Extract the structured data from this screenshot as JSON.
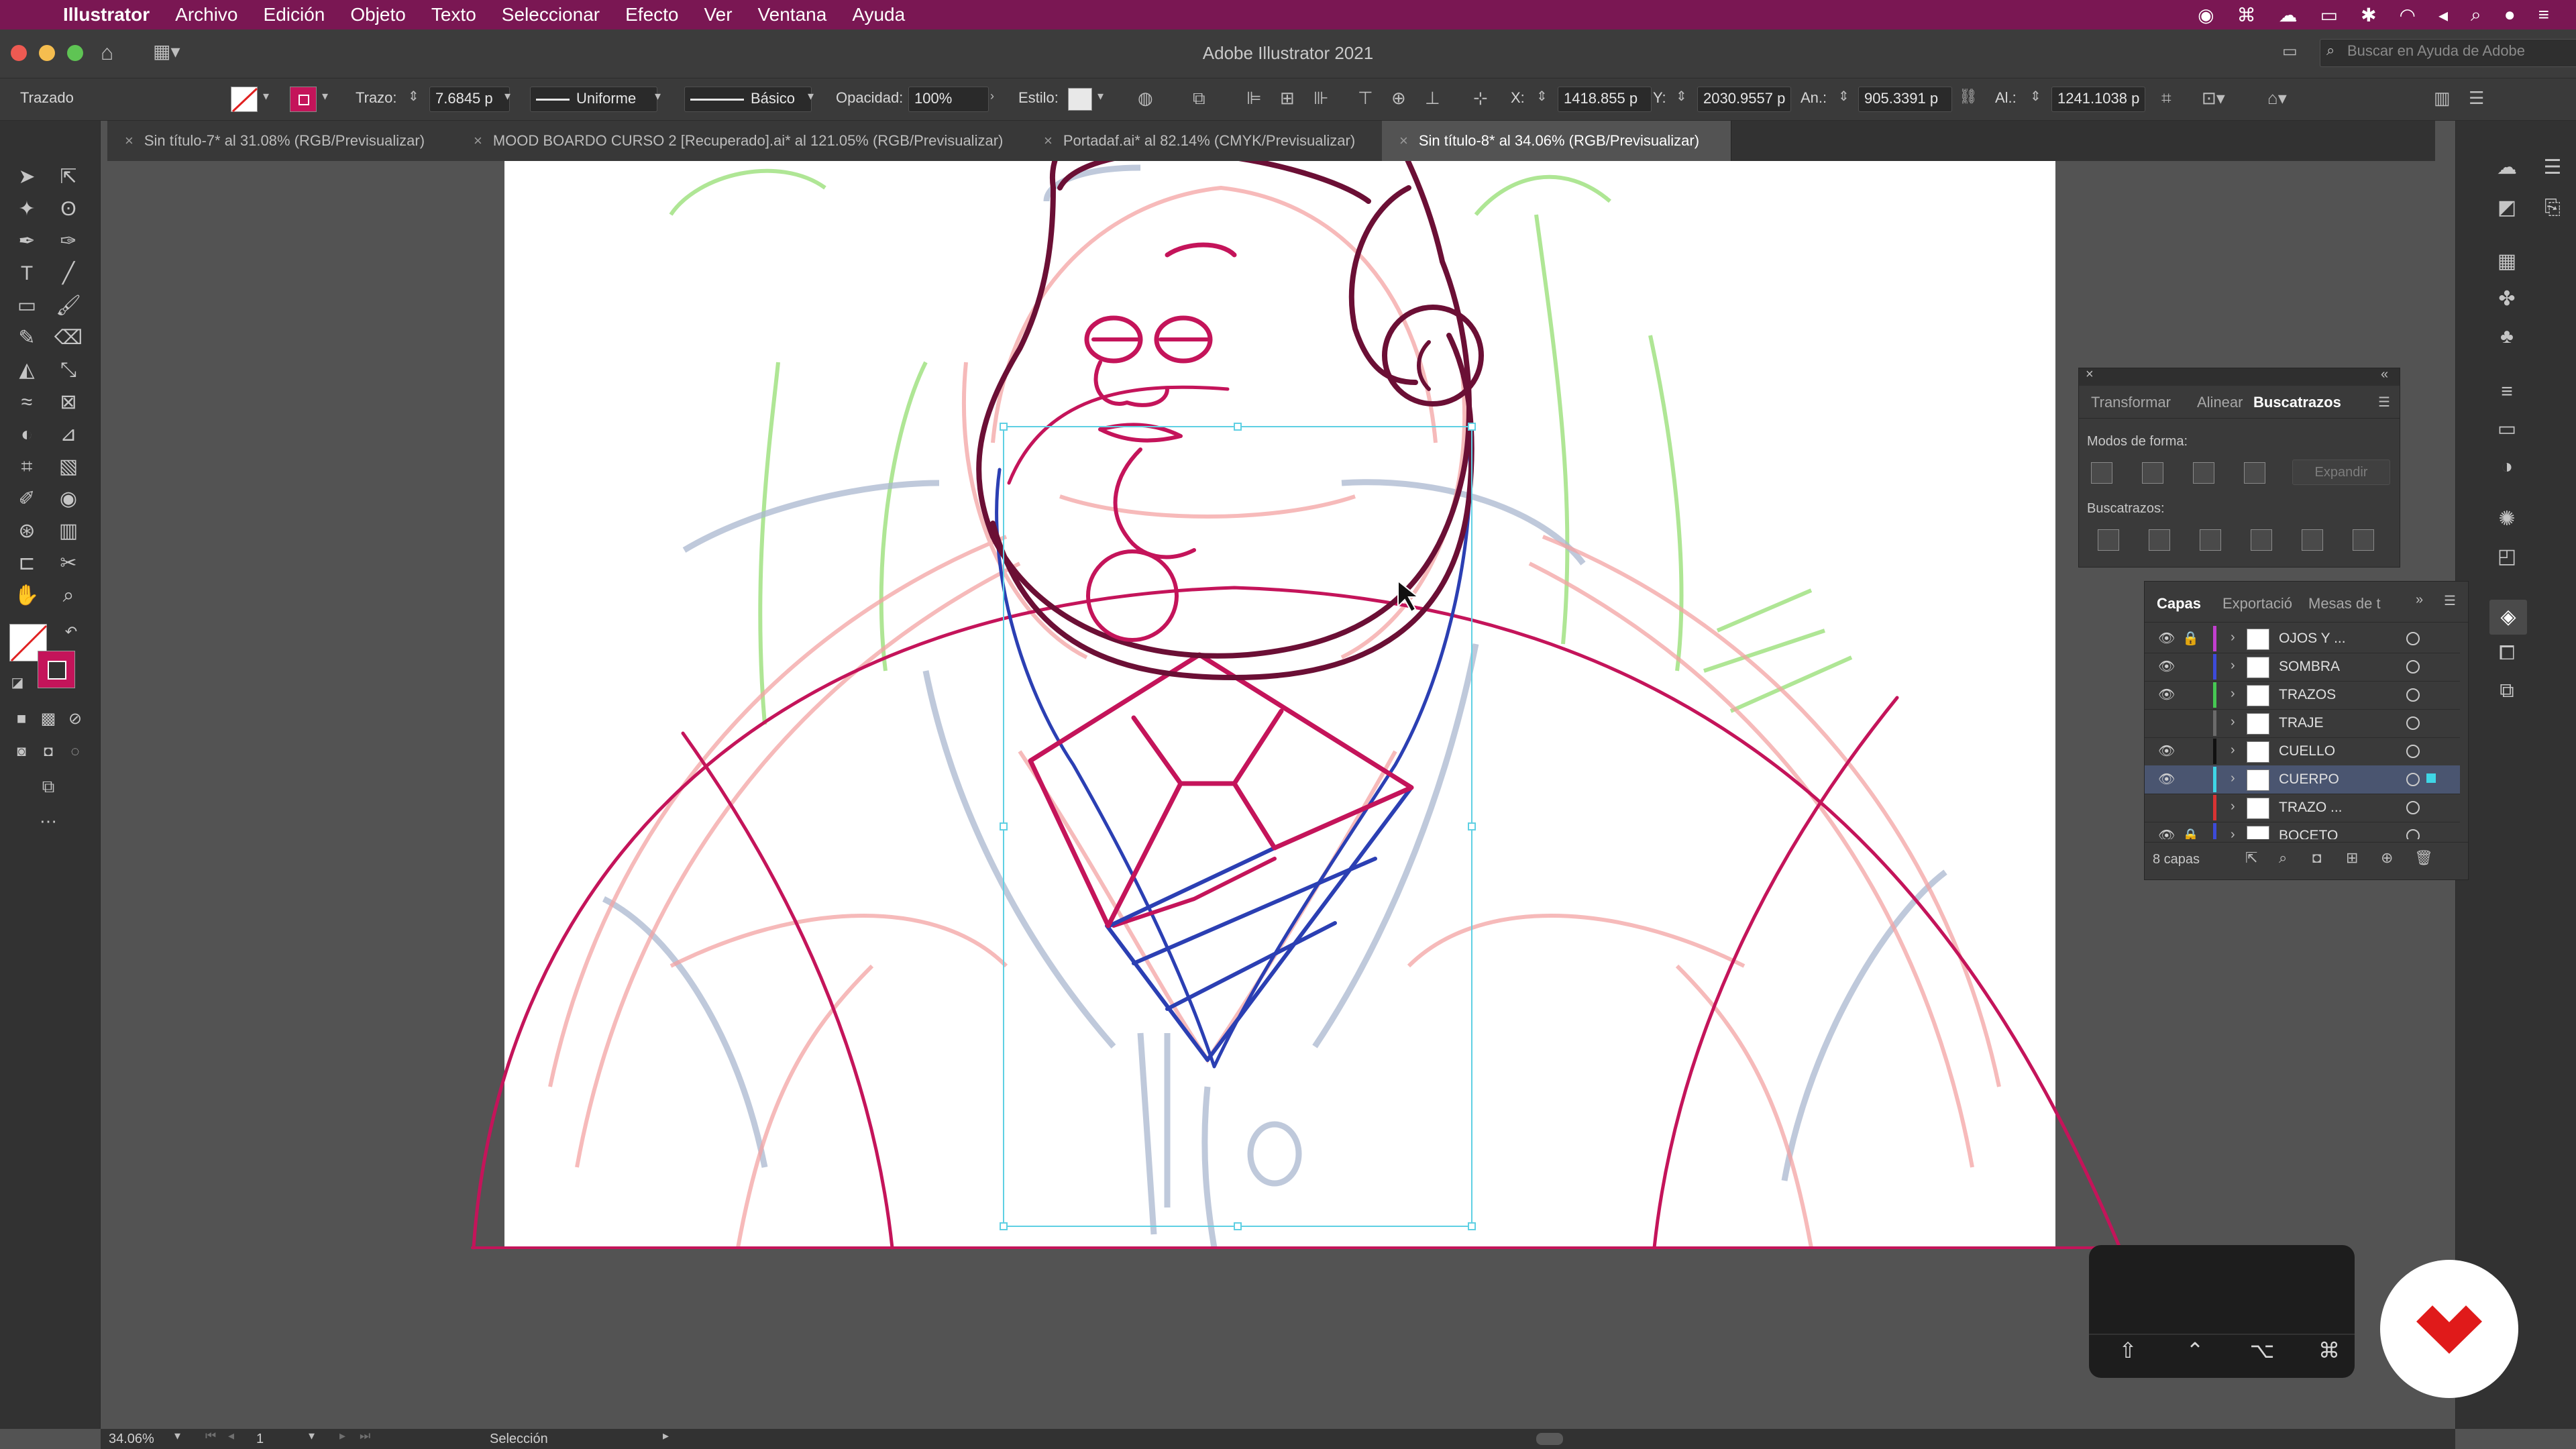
{
  "menubar": {
    "apple": "",
    "items": [
      "Illustrator",
      "Archivo",
      "Edición",
      "Objeto",
      "Texto",
      "Seleccionar",
      "Efecto",
      "Ver",
      "Ventana",
      "Ayuda"
    ],
    "right_icons": [
      "record-icon",
      "command-icon",
      "creative-cloud-icon",
      "airplay-icon",
      "bluetooth-icon",
      "wifi-icon",
      "volume-icon",
      "search-icon",
      "siri-icon",
      "control-center-icon"
    ]
  },
  "window": {
    "title": "Adobe Illustrator 2021",
    "search_placeholder": "Buscar en Ayuda de Adobe"
  },
  "controlbar": {
    "selection_label": "Trazado",
    "stroke_label": "Trazo:",
    "stroke_value": "7.6845 p",
    "profile_value": "Uniforme",
    "brush_value": "Básico",
    "opacity_label": "Opacidad:",
    "opacity_value": "100%",
    "style_label": "Estilo:",
    "x_label": "X:",
    "x_value": "1418.855 p",
    "y_label": "Y:",
    "y_value": "2030.9557 p",
    "w_label": "An.:",
    "w_value": "905.3391 p",
    "h_label": "Al.:",
    "h_value": "1241.1038 p"
  },
  "tabs": [
    {
      "label": "Sin título-7* al 31.08% (RGB/Previsualizar)",
      "active": false
    },
    {
      "label": "MOOD BOARDO CURSO 2 [Recuperado].ai* al 121.05% (RGB/Previsualizar)",
      "active": false
    },
    {
      "label": "Portadaf.ai* al 82.14% (CMYK/Previsualizar)",
      "active": false
    },
    {
      "label": "Sin título-8* al 34.06% (RGB/Previsualizar)",
      "active": true
    }
  ],
  "pathfinder_panel": {
    "tabs": [
      "Transformar",
      "Alinear",
      "Buscatrazos"
    ],
    "active_tab": "Buscatrazos",
    "shape_modes_label": "Modos de forma:",
    "expand_label": "Expandir",
    "pathfinders_label": "Buscatrazos:"
  },
  "layers_panel": {
    "tabs": [
      "Capas",
      "Exportació",
      "Mesas de t"
    ],
    "active_tab": "Capas",
    "layers": [
      {
        "name": "OJOS Y ...",
        "color": "#c23fd0",
        "visible": true,
        "locked": true,
        "selected": false
      },
      {
        "name": "SOMBRA",
        "color": "#3d4bd9",
        "visible": true,
        "locked": false,
        "selected": false
      },
      {
        "name": "TRAZOS",
        "color": "#46c853",
        "visible": true,
        "locked": false,
        "selected": false
      },
      {
        "name": "TRAJE",
        "color": "#6b6b6b",
        "visible": false,
        "locked": false,
        "selected": false
      },
      {
        "name": "CUELLO",
        "color": "#111111",
        "visible": true,
        "locked": false,
        "selected": false
      },
      {
        "name": "CUERPO",
        "color": "#3fd6e6",
        "visible": true,
        "locked": false,
        "selected": true
      },
      {
        "name": "TRAZO ...",
        "color": "#d93333",
        "visible": false,
        "locked": false,
        "selected": false
      },
      {
        "name": "BOCETO",
        "color": "#3d4bd9",
        "visible": true,
        "locked": true,
        "selected": false
      }
    ],
    "count_label": "8 capas"
  },
  "statusbar": {
    "zoom": "34.06%",
    "artboard": "1",
    "tool": "Selección"
  },
  "keyboard_overlay": {
    "keys": [
      "⇧",
      "⌃",
      "⌥",
      "⌘"
    ]
  },
  "colors": {
    "menubar": "#7a1753",
    "stroke_magenta": "#c4145a",
    "stroke_dark": "#6b0f35",
    "stroke_blue": "#2b3fb3",
    "sketch_red": "#f4a3a3",
    "sketch_green": "#9be07a",
    "sketch_blue": "#aab7cf",
    "selection_cyan": "#5fd0e3",
    "logo_red": "#e01a1a"
  }
}
